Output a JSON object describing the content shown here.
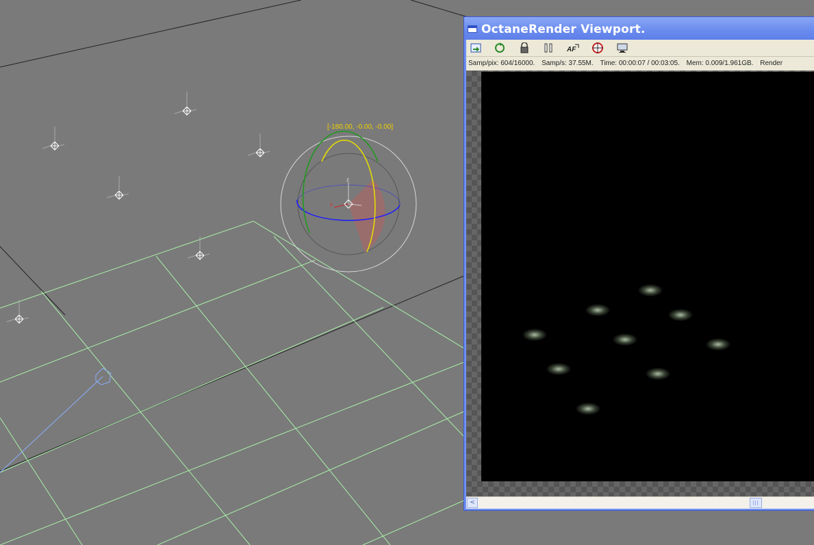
{
  "viewport": {
    "rotation_readout": "[-180.00, -0.00, -0.00]",
    "gizmo_axis_labels": {
      "x": "x",
      "y": "y",
      "z": "z"
    }
  },
  "octane": {
    "title": "OctaneRender Viewport.",
    "toolbar": {
      "icons": [
        "send-scene-icon",
        "restart-icon",
        "lock-icon",
        "pause-icon",
        "autofocus-icon",
        "focus-picker-icon",
        "render-settings-icon"
      ],
      "autofocus_label": "AF"
    },
    "status": {
      "samp_pix": "Samp/pix: 604/16000.",
      "samp_s": "Samp/s: 37.55M.",
      "time": "Time: 00:00:07 / 00:03:05.",
      "mem": "Mem: 0.009/1.961GB.",
      "render": "Render"
    },
    "scroll": {
      "left_arrow": "<"
    }
  },
  "colors": {
    "viewport_bg": "#7a7a7a",
    "grid_lines": "#a8f0a8",
    "readout_text": "#f0d000",
    "titlebar": "#6a8bee"
  }
}
